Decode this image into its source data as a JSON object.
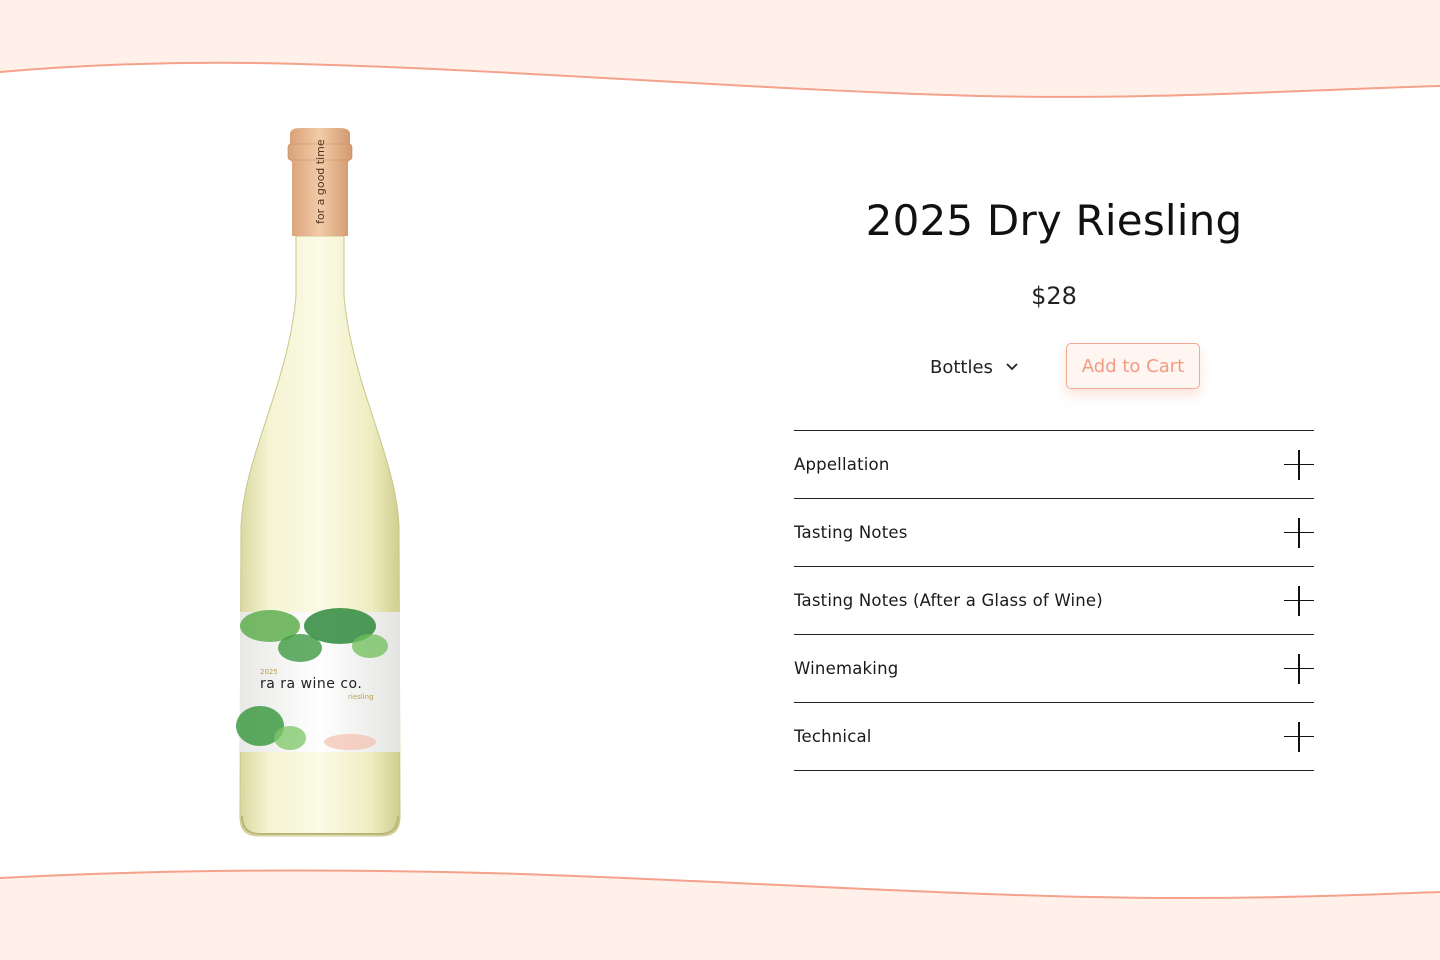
{
  "colors": {
    "accent": "#f4a28c",
    "wave_fill": "#fff1ea",
    "text": "#111111"
  },
  "product": {
    "title": "2025 Dry Riesling",
    "price": "$28",
    "quantity_select": {
      "selected": "Bottles"
    },
    "add_to_cart_label": "Add to Cart"
  },
  "bottle_label": {
    "neck_text": "for a good time",
    "year": "2025",
    "brand": "ra ra wine co.",
    "varietal": "riesling"
  },
  "accordion": {
    "items": [
      {
        "label": "Appellation"
      },
      {
        "label": "Tasting Notes"
      },
      {
        "label": "Tasting Notes (After a Glass of Wine)"
      },
      {
        "label": "Winemaking"
      },
      {
        "label": "Technical"
      }
    ]
  }
}
